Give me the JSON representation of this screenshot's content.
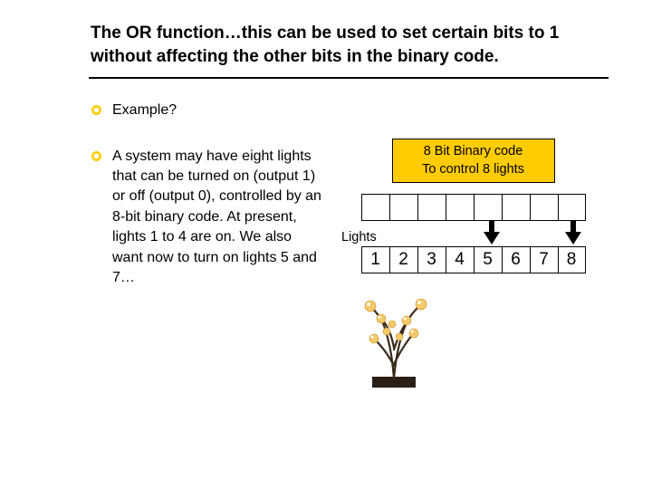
{
  "title": "The OR function…this can be used to set certain bits to 1 without affecting the other bits in the binary code.",
  "bullets": {
    "b1": "Example?",
    "b2": "A system may have eight lights that can be turned on (output 1) or off (output 0), controlled by an 8-bit binary code. At present, lights 1 to 4 are on. We also want now to turn on lights 5 and 7…"
  },
  "caption": {
    "line1": "8 Bit Binary code",
    "line2": "To control 8 lights"
  },
  "lights_label": "Lights",
  "light_numbers": [
    "1",
    "2",
    "3",
    "4",
    "5",
    "6",
    "7",
    "8"
  ],
  "icons": {
    "bullet": "hollow-circle-bullet",
    "arrow": "down-arrow",
    "tree": "decorative-light-tree"
  }
}
